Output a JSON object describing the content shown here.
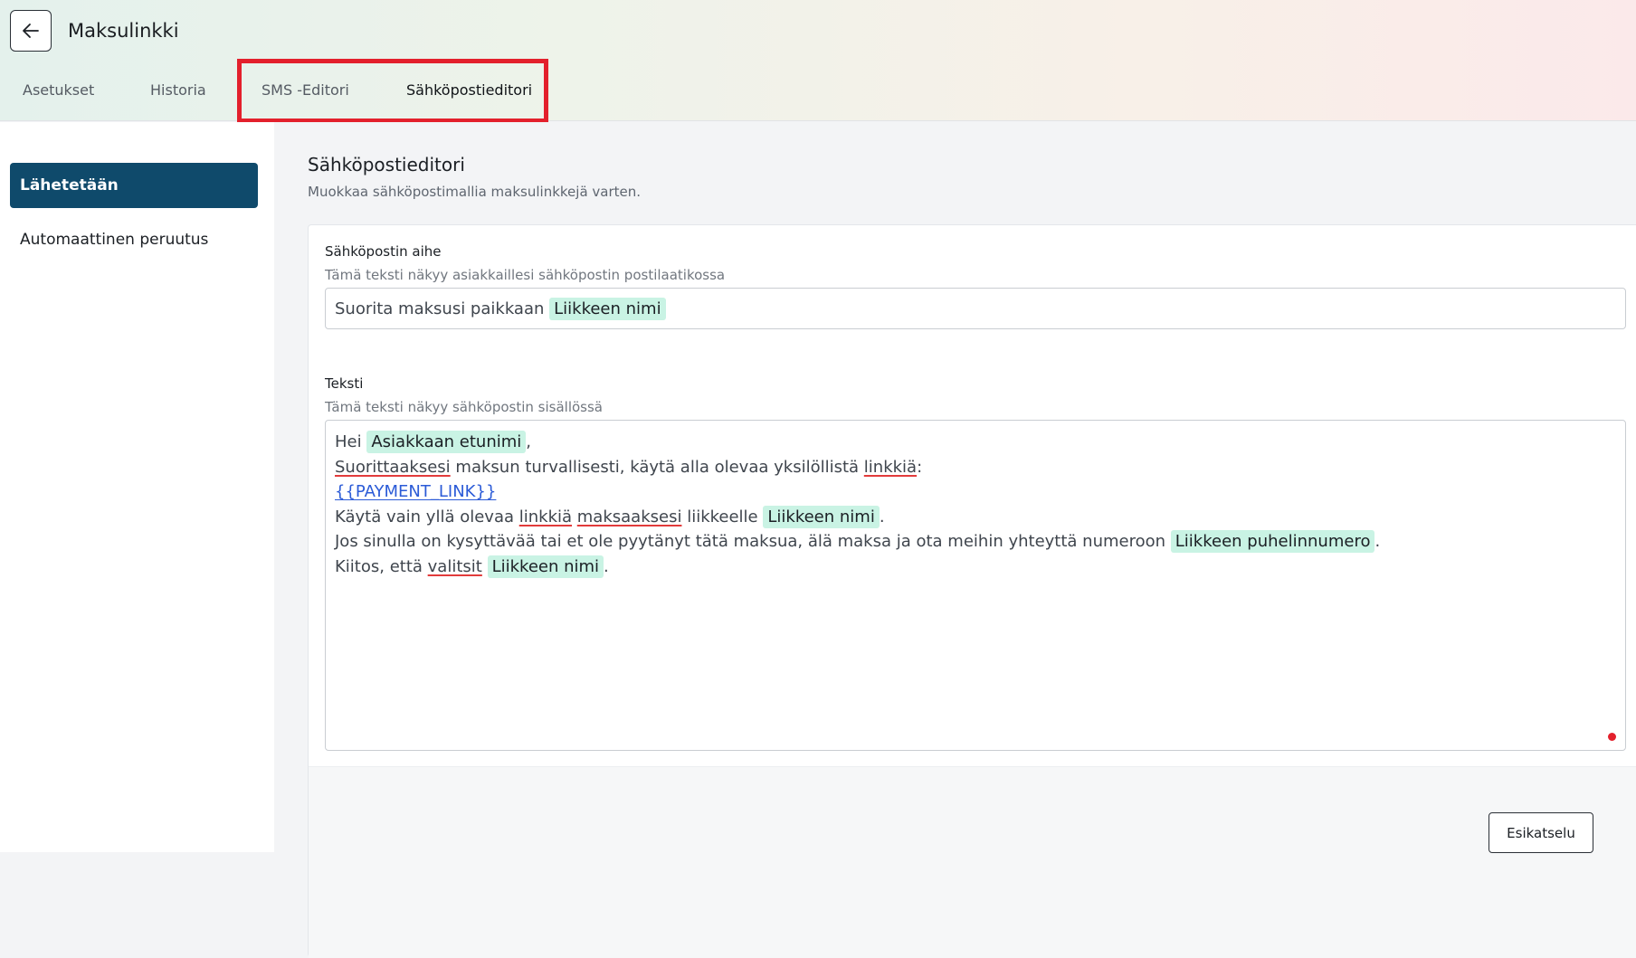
{
  "header": {
    "title": "Maksulinkki",
    "back_icon": "arrow-left-icon",
    "tabs": [
      {
        "label": "Asetukset"
      },
      {
        "label": "Historia"
      },
      {
        "label": "SMS -Editori"
      },
      {
        "label": "Sähköpostieditori",
        "active": true
      }
    ]
  },
  "sidebar": {
    "items": [
      {
        "label": "Lähetetään",
        "active": true
      },
      {
        "label": "Automaattinen peruutus"
      }
    ]
  },
  "main": {
    "title": "Sähköpostieditori",
    "subtitle": "Muokkaa sähköpostimallia maksulinkkejä varten.",
    "subject": {
      "label": "Sähköpostin aihe",
      "help": "Tämä teksti näkyy asiakkaillesi sähköpostin postilaatikossa",
      "text": "Suorita maksusi paikkaan",
      "tag": "Liikkeen nimi"
    },
    "body": {
      "label": "Teksti",
      "help": "Tämä teksti näkyy sähköpostin sisällössä",
      "line1": {
        "greeting": "Hei",
        "tag": "Asiakkaan etunimi",
        "end": ","
      },
      "line2": {
        "word1": "Suorittaaksesi",
        "middle": "maksun turvallisesti, käytä alla olevaa yksilöllistä",
        "word2": "linkkiä",
        "end": ":"
      },
      "line3": {
        "link": "{{PAYMENT_LINK}}"
      },
      "line4": {
        "start": "Käytä vain yllä olevaa",
        "word1": "linkkiä",
        "word2": "maksaaksesi",
        "middle": "liikkeelle",
        "tag": "Liikkeen nimi",
        "end": "."
      },
      "line5": {
        "start": "Jos sinulla on kysyttävää tai et ole pyytänyt tätä maksua, älä maksa ja ota meihin yhteyttä numeroon",
        "tag": "Liikkeen puhelinnumero",
        "end": "."
      },
      "line6": {
        "start": "Kiitos, että",
        "word1": "valitsit",
        "tag": "Liikkeen nimi",
        "end": "."
      }
    },
    "preview_button": "Esikatselu"
  },
  "colors": {
    "accent": "#0f4a6b",
    "tag_bg": "#c9f3e4",
    "highlight_border": "#e3202c",
    "link": "#2b5bd7"
  }
}
